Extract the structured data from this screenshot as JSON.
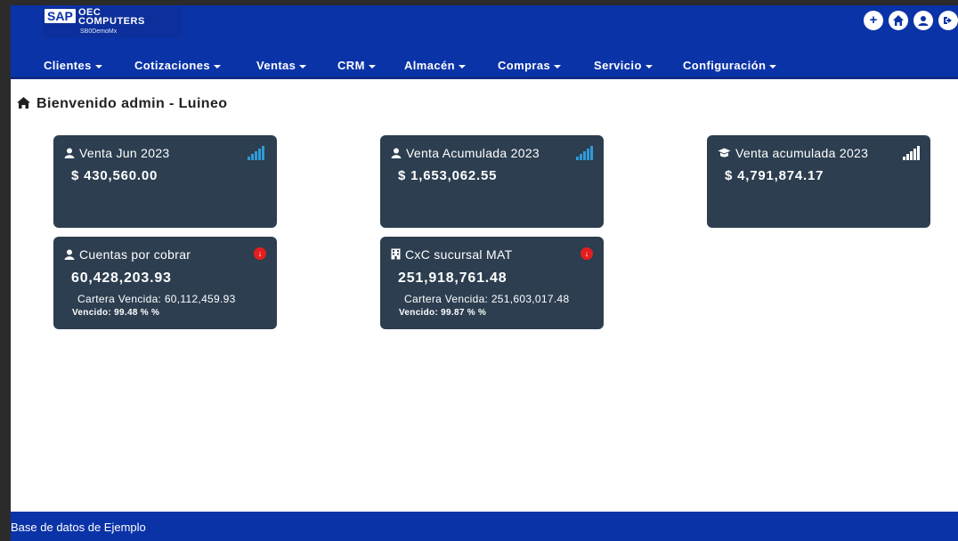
{
  "brand": {
    "sap": "SAP",
    "company_line1": "OEC",
    "company_line2": "COMPUTERS",
    "database_code": "SB0DemoMx"
  },
  "top_icons": [
    "add-circle-icon",
    "home-icon",
    "user-circle-icon",
    "logout-icon"
  ],
  "menu": [
    {
      "label": "Clientes"
    },
    {
      "label": "Cotizaciones"
    },
    {
      "label": "Ventas"
    },
    {
      "label": "CRM"
    },
    {
      "label": "Almacén"
    },
    {
      "label": "Compras"
    },
    {
      "label": "Servicio"
    },
    {
      "label": "Configuración"
    }
  ],
  "welcome": "Bienvenido admin - Luineo",
  "cards": [
    {
      "title": "Venta Jun 2023",
      "icon": "user-icon",
      "value": "$ 430,560.00",
      "indicator": "signal-icon"
    },
    {
      "title": "Venta Acumulada 2023",
      "icon": "user-icon",
      "value": "$ 1,653,062.55",
      "indicator": "signal-icon"
    },
    {
      "title": "Venta acumulada 2023",
      "icon": "graduation-cap-icon",
      "value": "$ 4,791,874.17",
      "indicator": "signal-icon"
    },
    {
      "title": "Cuentas por cobrar",
      "icon": "user-icon",
      "value": "60,428,203.93",
      "overdue": "Cartera Vencida: 60,112,459.93",
      "percent": "Vencido: 99.48 % %",
      "indicator": "alert-icon"
    },
    {
      "title": "CxC sucursal MAT",
      "icon": "building-icon",
      "value": "251,918,761.48",
      "overdue": "Cartera Vencida: 251,603,017.48",
      "percent": "Vencido: 99.87 % %",
      "indicator": "alert-icon"
    }
  ],
  "colors": {
    "header": "#0a33a8",
    "card": "#2c3e50",
    "signal_blue": "#2f9bd8",
    "signal_white": "#ffffff",
    "alert": "#e41e1e"
  },
  "footer": "Base de datos de Ejemplo"
}
